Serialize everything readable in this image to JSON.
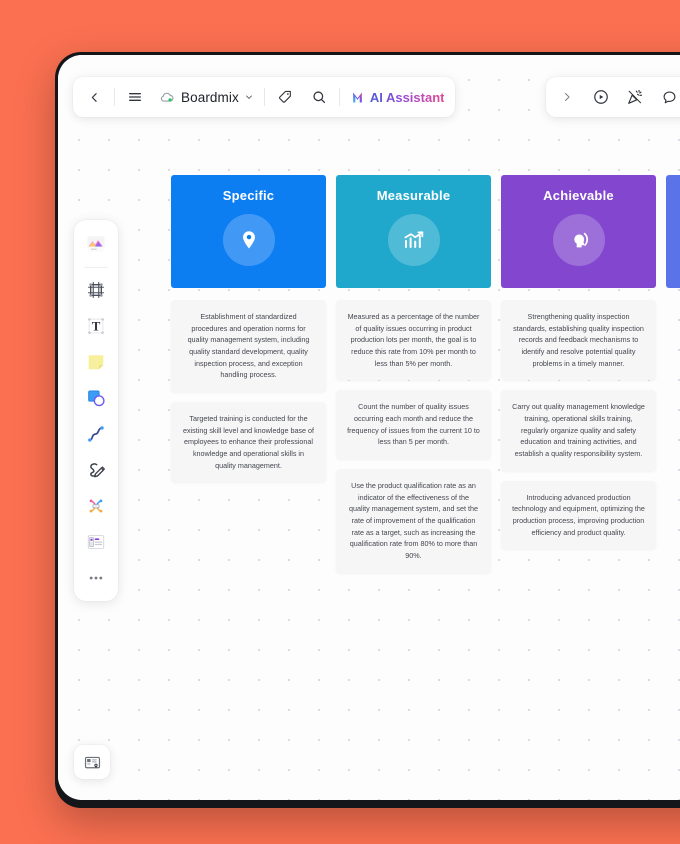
{
  "window": {
    "background_color": "#fb7051",
    "bezel_color": "#15161a",
    "canvas_color": "#fdfdfd"
  },
  "toolbar_left": {
    "back_label": "",
    "menu_label": "",
    "brand_label": "Boardmix",
    "brand_caret": "⌄",
    "tag_label": "",
    "search_label": "",
    "ai_label": "AI Assistant"
  },
  "toolbar_right": {
    "expand_label": "",
    "present_label": "",
    "celebrate_label": "",
    "comment_label": "",
    "history_label": ""
  },
  "tool_rail": {
    "items": [
      {
        "icon": "template-cards-icon",
        "name": "template"
      },
      {
        "icon": "frame-icon",
        "name": "frame"
      },
      {
        "icon": "text-icon",
        "name": "text"
      },
      {
        "icon": "sticky-note-icon",
        "name": "sticky-note"
      },
      {
        "icon": "shapes-icon",
        "name": "shapes"
      },
      {
        "icon": "curve-line-icon",
        "name": "curve"
      },
      {
        "icon": "pencil-draw-icon",
        "name": "pencil"
      },
      {
        "icon": "mind-map-icon",
        "name": "mind-map"
      },
      {
        "icon": "table-layout-icon",
        "name": "table"
      },
      {
        "icon": "more-dots-icon",
        "name": "more"
      }
    ]
  },
  "minimap": {
    "icon": "minimap-icon"
  },
  "board": {
    "columns": [
      {
        "title": "Specific",
        "color": "#0d7df2",
        "icon": "location-pin-icon",
        "notes": [
          "Establishment of standardized procedures and operation norms for quality management system, including quality standard development, quality inspection process, and exception handling process.",
          "Targeted training is conducted for the existing skill level and knowledge base of employees to enhance their professional knowledge and operational skills in quality management."
        ]
      },
      {
        "title": "Measurable",
        "color": "#1fa8cc",
        "icon": "growth-chart-icon",
        "notes": [
          "Measured as a percentage of the number of quality issues occurring in product production lots per month, the goal is to reduce this rate from 10% per month to less than 5% per month.",
          "Count the number of quality issues occurring each month and reduce the frequency of issues from the current 10 to less than 5 per month.",
          "Use the product qualification rate as an indicator of the effectiveness of the quality management system, and set the rate of improvement of the qualification rate as a target, such as increasing the qualification rate from 80% to more than 90%."
        ]
      },
      {
        "title": "Achievable",
        "color": "#8247ce",
        "icon": "head-profile-icon",
        "notes": [
          "Strengthening quality inspection standards, establishing quality inspection records and feedback mechanisms to identify and resolve potential quality problems in a timely manner.",
          "Carry out quality management knowledge training, operational skills training, regularly organize quality and safety education and training activities, and establish a quality responsibility system.",
          "Introducing advanced production technology and equipment, optimizing the production process, improving production efficiency and product quality."
        ]
      },
      {
        "title": "",
        "color": "#5b73e8",
        "icon": "",
        "notes": []
      }
    ]
  }
}
